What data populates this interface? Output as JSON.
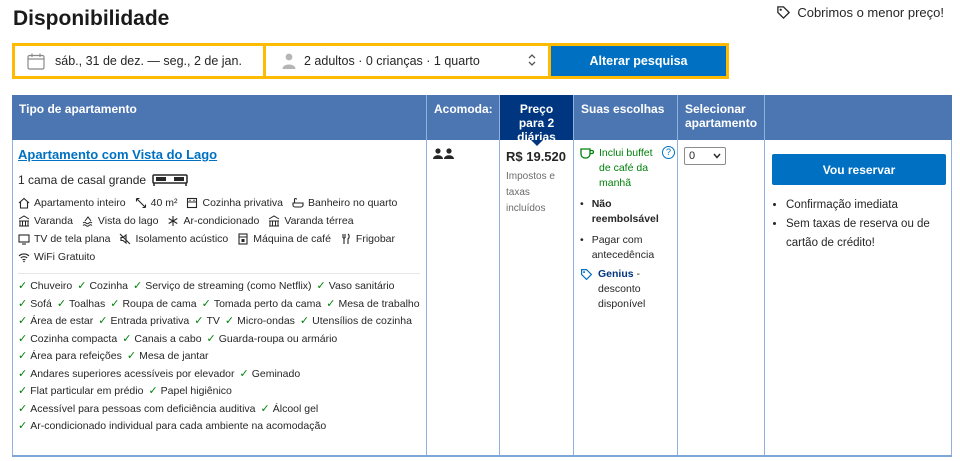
{
  "page": {
    "title": "Disponibilidade",
    "price_match": "Cobrimos o menor preço!"
  },
  "search": {
    "dates": "sáb., 31 de dez. — seg., 2 de jan.",
    "guests": "2 adultos · 0 crianças · 1 quarto",
    "button": "Alterar pesquisa"
  },
  "table": {
    "headers": {
      "room_type": "Tipo de apartamento",
      "sleeps": "Acomoda:",
      "price": "Preço para 2 diárias",
      "choices": "Suas escolhas",
      "select": "Selecionar apartamento"
    },
    "room": {
      "name": "Apartamento com Vista do Lago",
      "bed": "1 cama de casal grande",
      "features": [
        {
          "icon": "house-icon",
          "label": "Apartamento inteiro"
        },
        {
          "icon": "size-icon",
          "label": "40 m²"
        },
        {
          "icon": "kitchen-icon",
          "label": "Cozinha privativa"
        },
        {
          "icon": "bath-icon",
          "label": "Banheiro no quarto"
        },
        {
          "icon": "balcony-icon",
          "label": "Varanda"
        },
        {
          "icon": "lake-icon",
          "label": "Vista do lago"
        },
        {
          "icon": "snowflake-icon",
          "label": "Ar-condicionado"
        },
        {
          "icon": "terrace-icon",
          "label": "Varanda térrea"
        },
        {
          "icon": "tv-icon",
          "label": "TV de tela plana"
        },
        {
          "icon": "soundproof-icon",
          "label": "Isolamento acústico"
        },
        {
          "icon": "coffee-icon",
          "label": "Máquina de café"
        },
        {
          "icon": "fridge-icon",
          "label": "Frigobar"
        },
        {
          "icon": "wifi-icon",
          "label": "WiFi Gratuito"
        }
      ],
      "amenities": [
        "Chuveiro",
        "Cozinha",
        "Serviço de streaming (como Netflix)",
        "Vaso sanitário",
        "Sofá",
        "Toalhas",
        "Roupa de cama",
        "Tomada perto da cama",
        "Mesa de trabalho",
        "Área de estar",
        "Entrada privativa",
        "TV",
        "Micro-ondas",
        "Utensílios de cozinha",
        "Cozinha compacta",
        "Canais a cabo",
        "Guarda-roupa ou armário",
        "Área para refeições",
        "Mesa de jantar",
        "Andares superiores acessíveis por elevador",
        "Geminado",
        "Flat particular em prédio",
        "Papel higiênico",
        "Acessível para pessoas com deficiência auditiva",
        "Álcool gel",
        "Ar-condicionado individual para cada ambiente na acomodação"
      ],
      "price": "R$ 19.520",
      "price_note": "Impostos e taxas incluídos",
      "choices": {
        "breakfast": "Inclui buffet de café da manhã",
        "non_refundable": "Não reembolsável",
        "pay_advance": "Pagar com antecedência",
        "genius_label": "Genius",
        "genius_text": "desconto disponível"
      },
      "select_value": "0"
    },
    "reserve": {
      "button": "Vou reservar",
      "benefits": [
        "Confirmação imediata",
        "Sem taxas de reserva ou de cartão de crédito!"
      ]
    }
  },
  "colors": {
    "primary_blue": "#0071c2",
    "header_blue": "#4c76b2",
    "dark_blue": "#003580",
    "yellow": "#febb02",
    "green": "#008009"
  }
}
